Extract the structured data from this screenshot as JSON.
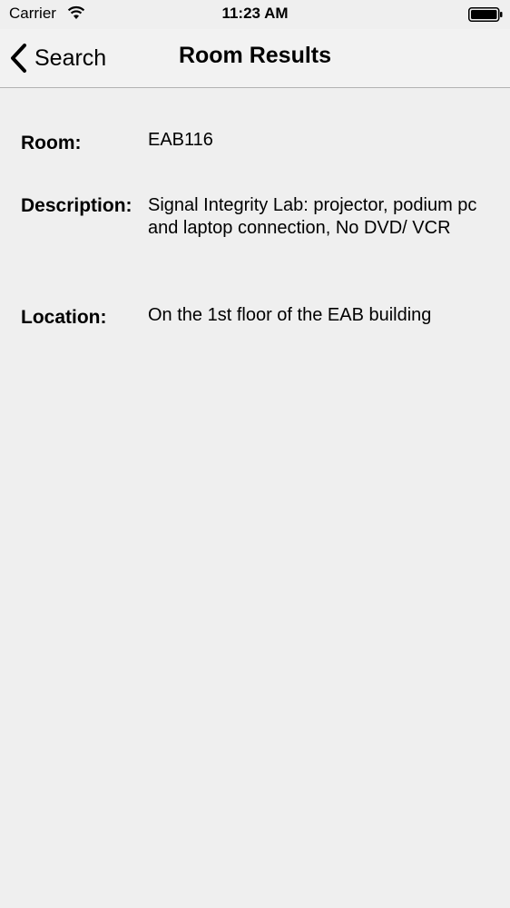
{
  "status_bar": {
    "carrier": "Carrier",
    "time": "11:23 AM",
    "wifi_icon": "wifi-icon",
    "battery_icon": "battery-icon"
  },
  "nav_bar": {
    "back_label": "Search",
    "back_icon": "chevron-left-icon",
    "title": "Room Results"
  },
  "details": {
    "room": {
      "label": "Room:",
      "value": "EAB116"
    },
    "description": {
      "label": "Description:",
      "value": "Signal Integrity Lab: projector, podium pc and laptop connection, No DVD/ VCR"
    },
    "location": {
      "label": "Location:",
      "value": "On the 1st floor of the EAB building"
    }
  }
}
